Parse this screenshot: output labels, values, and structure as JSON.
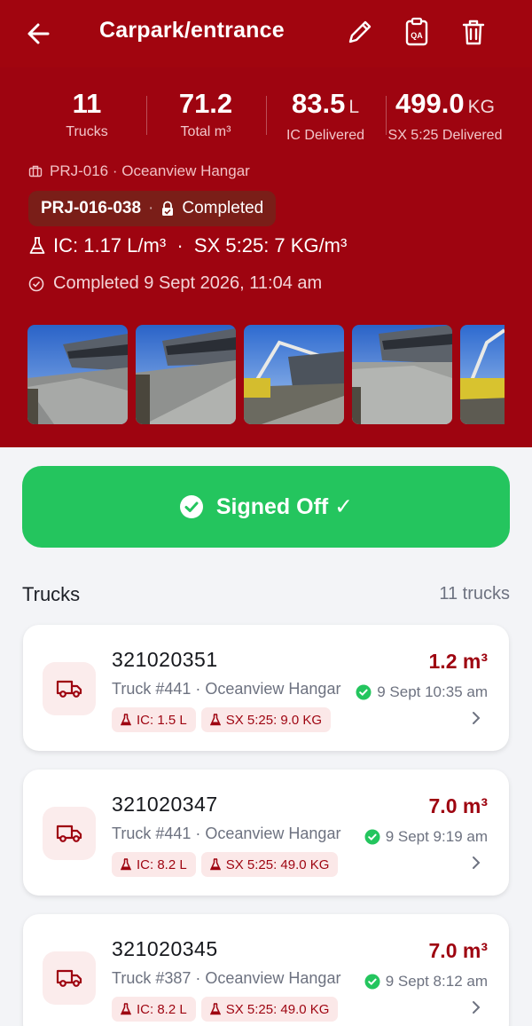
{
  "header": {
    "title": "Carpark/entrance",
    "back_icon": "arrow-left-icon",
    "actions": [
      "pencil-icon",
      "qa-clipboard-icon",
      "trash-icon"
    ],
    "qa_label": "QA"
  },
  "stats": [
    {
      "value": "11",
      "unit": "",
      "label": "Trucks"
    },
    {
      "value": "71.2",
      "unit": "",
      "label": "Total m³"
    },
    {
      "value": "83.5",
      "unit": "L",
      "label": "IC Delivered"
    },
    {
      "value": "499.0",
      "unit": "KG",
      "label": "SX 5:25 Delivered"
    }
  ],
  "project": {
    "text": "PRJ-016 · Oceanview Hangar",
    "code": "PRJ-016-038",
    "separator": "·",
    "status": "Completed",
    "metrics": "IC: 1.17 L/m³  ·  SX 5:25: 7 KG/m³",
    "completed_at": "Completed 9 Sept 2026, 11:04 am"
  },
  "signoff": {
    "label": "Signed Off ✓"
  },
  "trucks_section": {
    "title": "Trucks",
    "count": "11 trucks"
  },
  "trucks": [
    {
      "ticket": "321020351",
      "desc": "Truck #441 · Oceanview Hangar",
      "volume": "1.2 m³",
      "time": "9 Sept 10:35 am",
      "ic": "IC: 1.5 L",
      "sx": "SX 5:25: 9.0 KG"
    },
    {
      "ticket": "321020347",
      "desc": "Truck #441 · Oceanview Hangar",
      "volume": "7.0 m³",
      "time": "9 Sept 9:19 am",
      "ic": "IC: 8.2 L",
      "sx": "SX 5:25: 49.0 KG"
    },
    {
      "ticket": "321020345",
      "desc": "Truck #387 · Oceanview Hangar",
      "volume": "7.0 m³",
      "time": "9 Sept 8:12 am",
      "ic": "IC: 8.2 L",
      "sx": "SX 5:25: 49.0 KG"
    }
  ],
  "colors": {
    "brand": "#9e0410",
    "success": "#24c55e"
  }
}
